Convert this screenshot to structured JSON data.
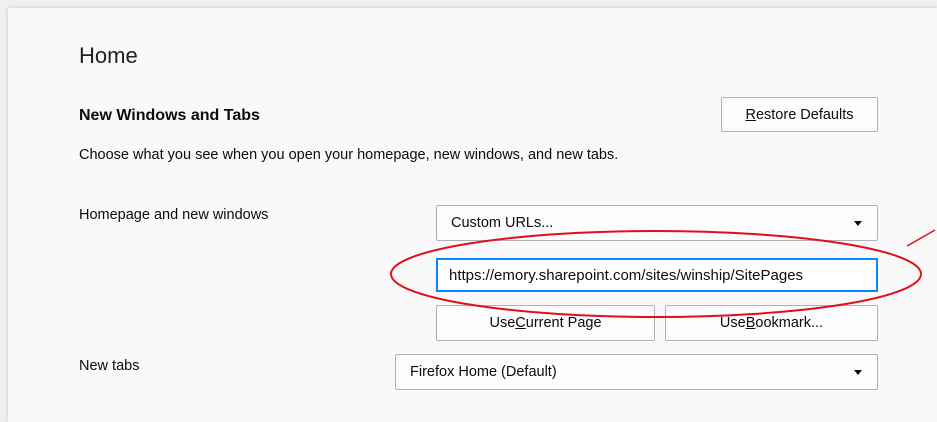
{
  "page": {
    "title": "Home"
  },
  "section": {
    "title": "New Windows and Tabs",
    "description": "Choose what you see when you open your homepage, new windows, and new tabs.",
    "restore_defaults": {
      "prefix": "",
      "accel": "R",
      "rest": "estore Defaults"
    }
  },
  "homepage": {
    "label": "Homepage and new windows",
    "select_value": "Custom URLs...",
    "url_value": "https://emory.sharepoint.com/sites/winship/SitePages",
    "use_current": {
      "prefix": "Use ",
      "accel": "C",
      "rest": "urrent Page"
    },
    "use_bookmark": {
      "prefix": "Use ",
      "accel": "B",
      "rest": "ookmark..."
    }
  },
  "new_tabs": {
    "label": "New tabs",
    "select_value": "Firefox Home (Default)"
  },
  "annotation": {
    "color": "#e0101a"
  }
}
